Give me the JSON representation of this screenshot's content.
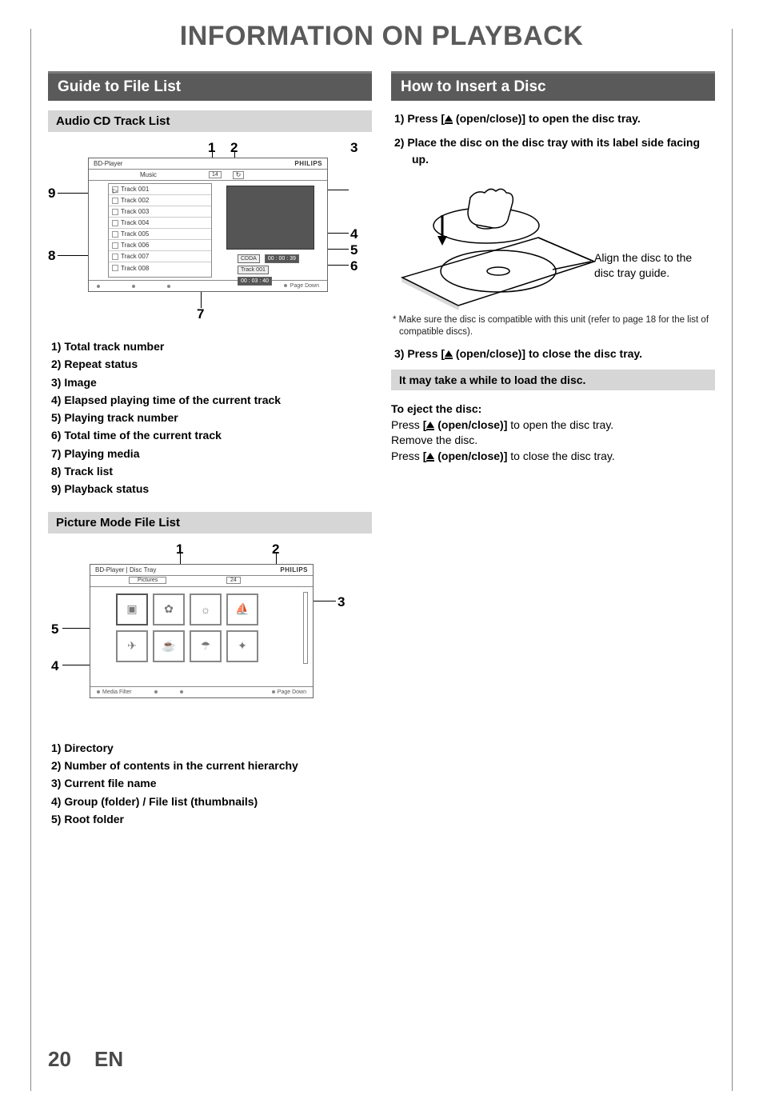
{
  "page_title": "INFORMATION ON PLAYBACK",
  "page_number": "20",
  "page_lang": "EN",
  "left": {
    "section_title": "Guide to File List",
    "sub1_title": "Audio CD Track List",
    "cd_screen": {
      "header_left": "BD-Player",
      "header_right": "PHILIPS",
      "sub_dir": "Music",
      "sub_count": "14",
      "tracks": [
        "Track  001",
        "Track  002",
        "Track  003",
        "Track  004",
        "Track  005",
        "Track  006",
        "Track  007",
        "Track  008"
      ],
      "tag_cdda": "CDDA",
      "tag_elapsed": "00 : 00 : 39",
      "tag_trackno": "Track 001",
      "tag_total": "00 : 03 : 40",
      "footer_pg": "Page Down"
    },
    "cd_callouts": [
      "1",
      "2",
      "3",
      "4",
      "5",
      "6",
      "7",
      "8",
      "9"
    ],
    "cd_legend": [
      "1)  Total track number",
      "2)  Repeat status",
      "3)  Image",
      "4)  Elapsed playing time of the current track",
      "5)  Playing track number",
      "6)  Total time of the current track",
      "7)  Playing media",
      "8)  Track list",
      "9)  Playback status"
    ],
    "sub2_title": "Picture Mode File List",
    "pic_screen": {
      "header_left": "BD-Player | Disc Tray",
      "header_right": "PHILIPS",
      "sub_dir": "Pictures",
      "sub_count": "24",
      "footer_filter": "Media Filter",
      "footer_pg": "Page Down"
    },
    "pic_callouts": [
      "1",
      "2",
      "3",
      "4",
      "5"
    ],
    "pic_legend": [
      "1)  Directory",
      "2)  Number of contents in the current  hierarchy",
      "3)  Current file name",
      "4)  Group (folder) / File list (thumbnails)",
      "5)  Root folder"
    ]
  },
  "right": {
    "section_title": "How to Insert a Disc",
    "step1_prefix": "1)  Press [",
    "step1_suffix": " (open/close)] to open the disc tray.",
    "step2": "2)  Place the disc on the disc tray with its label side facing up.",
    "disc_caption_l1": "Align the disc to the",
    "disc_caption_l2": "disc tray guide.",
    "asterisk_note": "*  Make sure the disc is compatible with this unit (refer to page 18 for the list of compatible discs).",
    "step3_prefix": "3)  Press [",
    "step3_suffix": " (open/close)] to close the disc tray.",
    "notice": "It may take a while to load the disc.",
    "eject_title": "To eject the disc:",
    "eject_l1_prefix": "Press ",
    "eject_l1_bracket_open": "[",
    "eject_l1_suffix": " (open/close)]",
    "eject_l1_rest": " to open the disc tray.",
    "eject_l2": "Remove the disc.",
    "eject_l3_prefix": "Press ",
    "eject_l3_bracket_open": "[",
    "eject_l3_suffix": " (open/close)]",
    "eject_l3_rest": " to close the disc tray."
  }
}
